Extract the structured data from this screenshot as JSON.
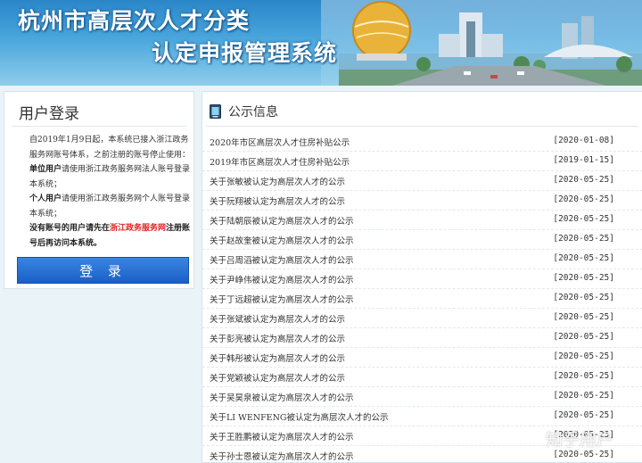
{
  "header": {
    "title_line1": "杭州市高层次人才分类",
    "title_line2": "认定申报管理系统"
  },
  "login": {
    "title": "用户登录",
    "notice_intro": "自2019年1月9日起，本系统已接入浙江政务服务网账号体系，之前注册的账号停止使用：",
    "unit_label": "单位用户",
    "unit_text": "请使用浙江政务服务网法人账号登录本系统；",
    "personal_label": "个人用户",
    "personal_text": "请使用浙江政务服务网个人账号登录本系统；",
    "no_account_a": "没有账号的用户请先在",
    "no_account_link": "浙江政务服务网",
    "no_account_b": "注册账号后再访问本系统。",
    "button_label": "登 录"
  },
  "announcements": {
    "title": "公示信息",
    "items": [
      {
        "title": "2020年市区高层次人才住房补贴公示",
        "date": "[2020-01-08]"
      },
      {
        "title": "2019年市区高层次人才住房补贴公示",
        "date": "[2019-01-15]"
      },
      {
        "title": "关于张敏被认定为高层次人才的公示",
        "date": "[2020-05-25]"
      },
      {
        "title": "关于阮翔被认定为高层次人才的公示",
        "date": "[2020-05-25]"
      },
      {
        "title": "关于陆朝辰被认定为高层次人才的公示",
        "date": "[2020-05-25]"
      },
      {
        "title": "关于赵故奎被认定为高层次人才的公示",
        "date": "[2020-05-25]"
      },
      {
        "title": "关于吕周滔被认定为高层次人才的公示",
        "date": "[2020-05-25]"
      },
      {
        "title": "关于尹峥伟被认定为高层次人才的公示",
        "date": "[2020-05-25]"
      },
      {
        "title": "关于丁远超被认定为高层次人才的公示",
        "date": "[2020-05-25]"
      },
      {
        "title": "关于张斌被认定为高层次人才的公示",
        "date": "[2020-05-25]"
      },
      {
        "title": "关于彭亮被认定为高层次人才的公示",
        "date": "[2020-05-25]"
      },
      {
        "title": "关于韩彤被认定为高层次人才的公示",
        "date": "[2020-05-25]"
      },
      {
        "title": "关于党颖被认定为高层次人才的公示",
        "date": "[2020-05-25]"
      },
      {
        "title": "关于吴昊泉被认定为高层次人才的公示",
        "date": "[2020-05-25]"
      },
      {
        "title": "关于LI WENFENG被认定为高层次人才的公示",
        "date": "[2020-05-25]"
      },
      {
        "title": "关于王胜鹏被认定为高层次人才的公示",
        "date": "[2020-05-25]"
      },
      {
        "title": "关于孙士恩被认定为高层次人才的公示",
        "date": "[2020-05-25]"
      }
    ]
  },
  "watermark": "知乎用户",
  "colors": {
    "accent_blue": "#1a5fc7",
    "banner_blue": "#2a86c8",
    "link_red": "#dd2222"
  }
}
